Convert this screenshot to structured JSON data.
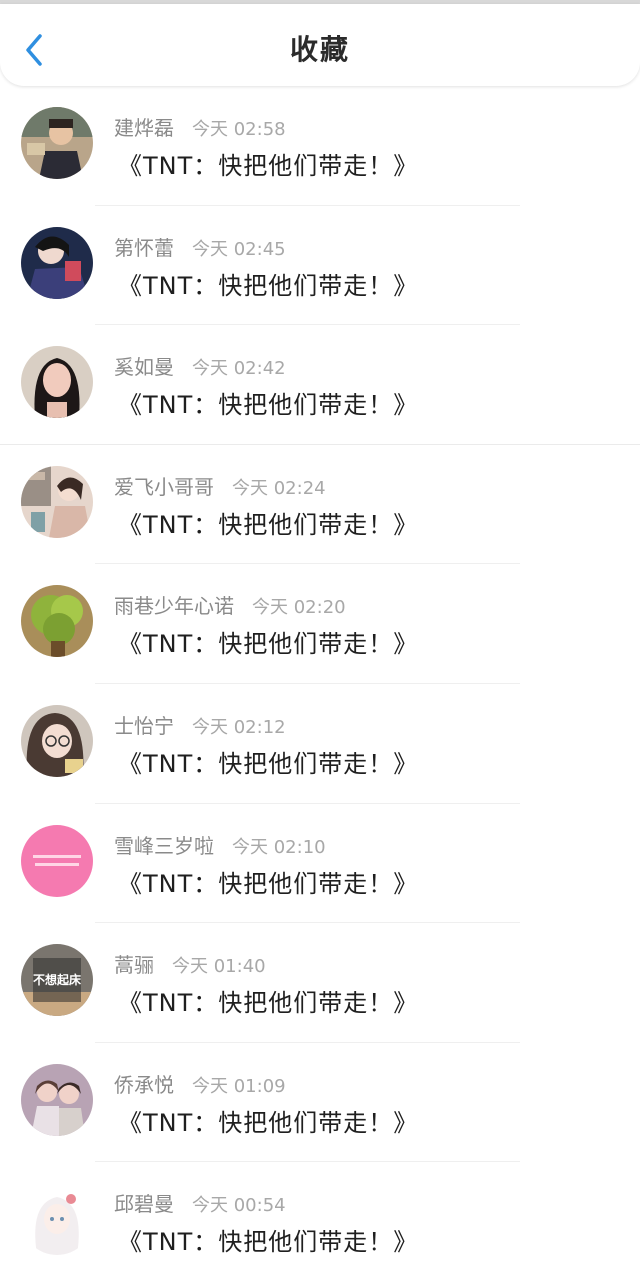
{
  "header": {
    "title": "收藏",
    "back_icon": "chevron-left-icon",
    "accent_color": "#2f8fe0"
  },
  "items": [
    {
      "name": "建烨磊",
      "time": "今天 02:58",
      "message": "《TNT：快把他们带走！》"
    },
    {
      "name": "第怀蕾",
      "time": "今天 02:45",
      "message": "《TNT：快把他们带走！》"
    },
    {
      "name": "奚如曼",
      "time": "今天 02:42",
      "message": "《TNT：快把他们带走！》"
    },
    {
      "name": "爱飞小哥哥",
      "time": "今天 02:24",
      "message": "《TNT：快把他们带走！》"
    },
    {
      "name": "雨巷少年心诺",
      "time": "今天 02:20",
      "message": "《TNT：快把他们带走！》"
    },
    {
      "name": "士怡宁",
      "time": "今天 02:12",
      "message": "《TNT：快把他们带走！》"
    },
    {
      "name": "雪峰三岁啦",
      "time": "今天 02:10",
      "message": "《TNT：快把他们带走！》"
    },
    {
      "name": "蒿骊",
      "time": "今天 01:40",
      "message": "《TNT：快把他们带走！》"
    },
    {
      "name": "侨承悦",
      "time": "今天 01:09",
      "message": "《TNT：快把他们带走！》"
    },
    {
      "name": "邱碧曼",
      "time": "今天 00:54",
      "message": "《TNT：快把他们带走！》"
    }
  ],
  "avatar_texts": {
    "item_8": "不想起床"
  }
}
